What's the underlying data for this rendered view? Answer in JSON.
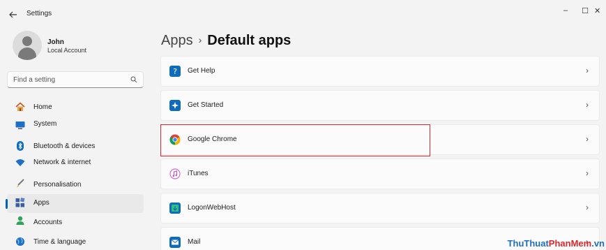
{
  "window": {
    "title": "Settings",
    "controls": {
      "minimize": "–",
      "maximize": "☐",
      "close": "✕"
    }
  },
  "profile": {
    "name": "John",
    "account_type": "Local Account"
  },
  "search": {
    "placeholder": "Find a setting"
  },
  "nav": {
    "active_index": 6,
    "items": [
      {
        "label": "Home",
        "icon": "home-icon"
      },
      {
        "label": "System",
        "icon": "system-icon"
      },
      {
        "label": "Bluetooth & devices",
        "icon": "bluetooth-icon"
      },
      {
        "label": "Network & internet",
        "icon": "wifi-icon"
      },
      {
        "label": "Personalisation",
        "icon": "brush-icon"
      },
      {
        "label": "Apps",
        "icon": "apps-icon"
      },
      {
        "label": "Accounts",
        "icon": "accounts-icon"
      },
      {
        "label": "Time & language",
        "icon": "globe-icon"
      }
    ]
  },
  "breadcrumb": {
    "parent": "Apps",
    "separator": "›",
    "current": "Default apps"
  },
  "apps": [
    {
      "name": "Get Help",
      "icon": "get-help-icon"
    },
    {
      "name": "Get Started",
      "icon": "get-started-icon"
    },
    {
      "name": "Google Chrome",
      "icon": "chrome-icon",
      "highlighted": true
    },
    {
      "name": "iTunes",
      "icon": "itunes-icon"
    },
    {
      "name": "LogonWebHost",
      "icon": "logon-web-host-icon"
    },
    {
      "name": "Mail",
      "icon": "mail-icon"
    }
  ],
  "chevron": "›",
  "watermark": {
    "part1": "ThuThuat",
    "part2": "PhanMem",
    "part3": ".vn"
  },
  "colors": {
    "accent": "#005fb8",
    "highlight": "#e0262b"
  }
}
